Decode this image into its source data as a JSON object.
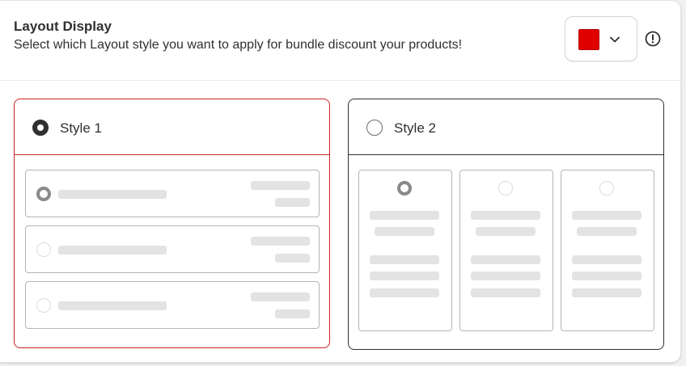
{
  "header": {
    "title": "Layout Display",
    "subtitle": "Select which Layout style you want to apply for bundle discount your products!"
  },
  "color_picker": {
    "color": "#e00000",
    "icon": "chevron-down-icon"
  },
  "info": {
    "icon": "alert-circle-icon"
  },
  "options": [
    {
      "label": "Style 1",
      "selected": true,
      "border_color": "#cc2222"
    },
    {
      "label": "Style 2",
      "selected": false,
      "border_color": "#303030"
    }
  ],
  "colors": {
    "accent": "#cc2222",
    "placeholder": "#e3e3e3",
    "text": "#303030"
  }
}
